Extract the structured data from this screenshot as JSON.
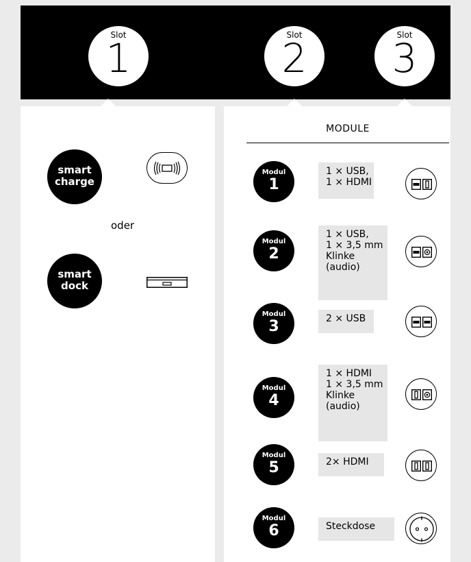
{
  "slots": [
    {
      "label": "Slot",
      "number": "1"
    },
    {
      "label": "Slot",
      "number": "2"
    },
    {
      "label": "Slot",
      "number": "3"
    }
  ],
  "left": {
    "smart_charge": {
      "line1": "smart",
      "line2": "charge",
      "icon": "wireless-charger-icon"
    },
    "oder": "oder",
    "smart_dock": {
      "line1": "smart",
      "line2": "dock",
      "icon": "dock-drawer-icon"
    }
  },
  "right": {
    "header": "MODULE",
    "modules": [
      {
        "label": "Modul",
        "number": "1",
        "desc": "1 × USB,\n1 × HDMI",
        "icons": [
          "usb-port-icon",
          "hdmi-port-icon"
        ]
      },
      {
        "label": "Modul",
        "number": "2",
        "desc": "1 × USB,\n1 × 3,5 mm\nKlinke\n(audio)",
        "icons": [
          "usb-port-icon",
          "audio-jack-icon"
        ]
      },
      {
        "label": "Modul",
        "number": "3",
        "desc": "2 × USB",
        "icons": [
          "usb-port-icon",
          "usb-port-icon"
        ]
      },
      {
        "label": "Modul",
        "number": "4",
        "desc": "1 × HDMI\n1 × 3,5 mm\nKlinke\n(audio)",
        "icons": [
          "hdmi-port-icon",
          "audio-jack-icon"
        ]
      },
      {
        "label": "Modul",
        "number": "5",
        "desc": "2× HDMI",
        "icons": [
          "hdmi-port-icon",
          "hdmi-port-icon"
        ]
      },
      {
        "label": "Modul",
        "number": "6",
        "desc": "Steckdose",
        "icons": [
          "power-socket-icon"
        ]
      }
    ]
  }
}
